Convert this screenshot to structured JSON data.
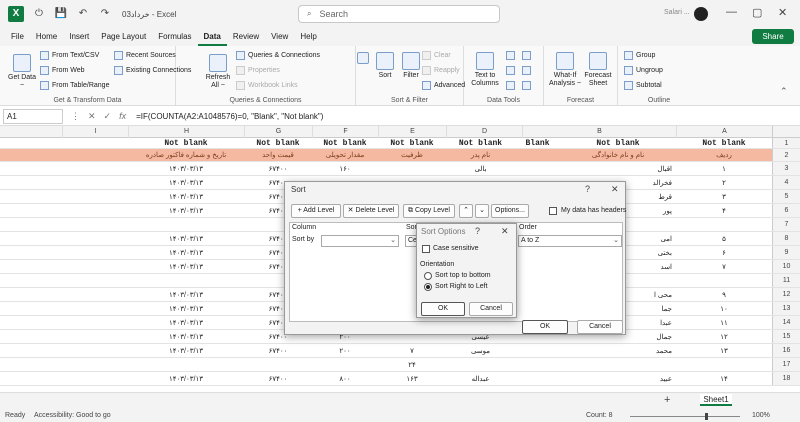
{
  "titlebar": {
    "doc_title": "خرداد03  -  Excel",
    "search_placeholder": "Search",
    "user_name": "Salari ..."
  },
  "menu": {
    "items": [
      "File",
      "Home",
      "Insert",
      "Page Layout",
      "Formulas",
      "Data",
      "Review",
      "View",
      "Help"
    ],
    "active": "Data",
    "share_label": "Share"
  },
  "ribbon": {
    "get_transform": {
      "label": "Get & Transform Data",
      "get_data": "Get Data",
      "get_data_sub": "~",
      "from_text": "From Text/CSV",
      "from_web": "From Web",
      "from_table": "From Table/Range",
      "recent_sources": "Recent Sources",
      "existing_connections": "Existing Connections"
    },
    "queries": {
      "label": "Queries & Connections",
      "refresh": "Refresh",
      "refresh_sub": "All ~",
      "queries_connections": "Queries & Connections",
      "properties": "Properties",
      "workbook_links": "Workbook Links"
    },
    "sort_filter": {
      "label": "Sort & Filter",
      "sort": "Sort",
      "filter": "Filter",
      "clear": "Clear",
      "reapply": "Reapply",
      "advanced": "Advanced"
    },
    "data_tools": {
      "label": "Data Tools",
      "text_to_columns": "Text to",
      "text_to_columns_2": "Columns"
    },
    "forecast": {
      "label": "Forecast",
      "what_if": "What-If",
      "what_if_2": "Analysis ~",
      "forecast_sheet": "Forecast",
      "forecast_sheet_2": "Sheet"
    },
    "outline": {
      "label": "Outline",
      "group": "Group",
      "ungroup": "Ungroup",
      "subtotal": "Subtotal"
    }
  },
  "formula_bar": {
    "name_box": "A1",
    "fx": "fx",
    "formula": "=IF(COUNTA(A2:A1048576)=0, \"Blank\", \"Not blank\")"
  },
  "grid": {
    "columns": [
      "A",
      "B",
      "C",
      "D",
      "E",
      "F",
      "G",
      "H",
      "I"
    ],
    "header_row1": [
      "Not blank",
      "Not blank",
      "Blank",
      "Not blank",
      "Not blank",
      "Not blank",
      "Not blank",
      "Not blank"
    ],
    "header_row2": [
      "ردیف",
      "نام و نام خانوادگی",
      "",
      "نام پدر",
      "ظرفیت",
      "مقدار تحویلی",
      "قیمت واحد",
      "تاریخ و شماره فاکتور صادره"
    ],
    "row_numbers": [
      "1",
      "2",
      "3",
      "4",
      "5",
      "6",
      "7",
      "8",
      "9",
      "10",
      "11",
      "12",
      "13",
      "14",
      "15",
      "16",
      "17",
      "18",
      "19",
      "20"
    ],
    "rows": [
      {
        "a": "۱",
        "b": "اقبال",
        "d": "بالی",
        "e": "",
        "f": "۱۶۰",
        "g": "۶۷۴۰۰",
        "h": "۱۴۰۳/۰۳/۱۳"
      },
      {
        "a": "۲",
        "b": "فخرالد",
        "d": "",
        "e": "",
        "f": "",
        "g": "۶۷۴۰۰",
        "h": "۱۴۰۳/۰۳/۱۳"
      },
      {
        "a": "۳",
        "b": "قرط",
        "d": "",
        "e": "",
        "f": "",
        "g": "۶۷۴۰۰",
        "h": "۱۴۰۳/۰۳/۱۳"
      },
      {
        "a": "۴",
        "b": "پور",
        "d": "",
        "e": "",
        "f": "",
        "g": "۶۷۴۰۰",
        "h": "۱۴۰۳/۰۳/۱۳"
      },
      {
        "a": "",
        "b": "",
        "d": "",
        "e": "",
        "f": "",
        "g": "",
        "h": ""
      },
      {
        "a": "۵",
        "b": "امی",
        "d": "",
        "e": "",
        "f": "",
        "g": "۶۷۴۰۰",
        "h": "۱۴۰۳/۰۳/۱۳"
      },
      {
        "a": "۶",
        "b": "بختی",
        "d": "",
        "e": "",
        "f": "",
        "g": "۶۷۴۰۰",
        "h": "۱۴۰۳/۰۳/۱۳"
      },
      {
        "a": "۷",
        "b": "اسد",
        "d": "",
        "e": "",
        "f": "",
        "g": "۶۷۴۰۰",
        "h": "۱۴۰۳/۰۳/۱۳"
      },
      {
        "a": "",
        "b": "",
        "d": "",
        "e": "",
        "f": "",
        "g": "",
        "h": ""
      },
      {
        "a": "۹",
        "b": "محی ا",
        "d": "",
        "e": "",
        "f": "",
        "g": "۶۷۴۰۰",
        "h": "۱۴۰۳/۰۳/۱۳"
      },
      {
        "a": "۱۰",
        "b": "جما",
        "d": "",
        "e": "",
        "f": "",
        "g": "۶۷۴۰۰",
        "h": "۱۴۰۳/۰۳/۱۳"
      },
      {
        "a": "۱۱",
        "b": "عبدا",
        "d": "",
        "e": "",
        "f": "",
        "g": "۶۷۴۰۰",
        "h": "۱۴۰۳/۰۳/۱۳"
      },
      {
        "a": "۱۲",
        "b": "جمال",
        "d": "عیسی",
        "e": "",
        "f": "۲۰۰",
        "g": "۶۷۴۰۰",
        "h": "۱۴۰۳/۰۳/۱۳"
      },
      {
        "a": "۱۳",
        "b": "محمد",
        "d": "موسی",
        "e": "۷",
        "f": "۲۰۰",
        "g": "۶۷۴۰۰",
        "h": "۱۴۰۳/۰۳/۱۳"
      },
      {
        "a": "",
        "b": "",
        "d": "",
        "e": "۲۴",
        "f": "",
        "g": "",
        "h": ""
      },
      {
        "a": "۱۴",
        "b": "عبید",
        "d": "عبداله",
        "e": "۱۶۳",
        "f": "۸۰۰",
        "g": "۶۷۴۰۰",
        "h": "۱۴۰۳/۰۳/۱۳"
      }
    ]
  },
  "status": {
    "ready": "Ready",
    "accessibility": "Accessibility: Good to go",
    "count": "Count: 8",
    "zoom": "100%",
    "sheet": "Sheet1",
    "add_sheet": "+"
  },
  "sort_dialog": {
    "title": "Sort",
    "add_level": "Add Level",
    "delete_level": "Delete Level",
    "copy_level": "Copy Level",
    "options": "Options...",
    "my_data_headers": "My data has headers",
    "col_column": "Column",
    "col_sort_on": "Sort",
    "col_order": "Order",
    "sort_by": "Sort by",
    "sort_on_value": "Cel",
    "order_value": "A to Z",
    "ok": "OK",
    "cancel": "Cancel",
    "help": "?",
    "close": "✕"
  },
  "options_dialog": {
    "title": "Sort Options",
    "help": "?",
    "close": "✕",
    "case_sensitive": "Case sensitive",
    "orientation": "Orientation",
    "top_to_bottom": "Sort top to bottom",
    "right_to_left": "Sort Right to Left",
    "ok": "OK",
    "cancel": "Cancel"
  }
}
